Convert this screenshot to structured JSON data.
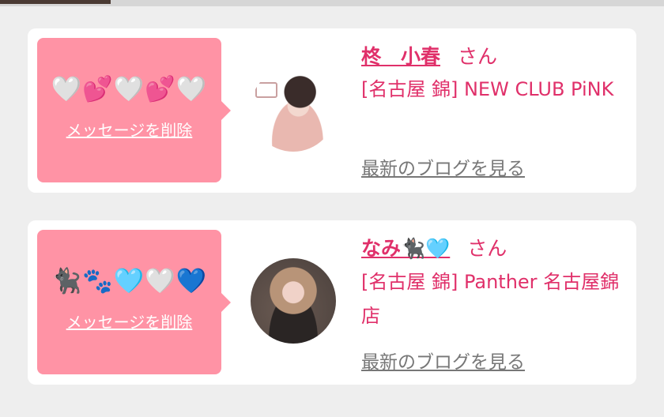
{
  "favorites": [
    {
      "name": "柊　小春",
      "suffix": "さん",
      "shop": "[名古屋 錦] NEW CLUB PiNK",
      "message": "🤍💕🤍💕🤍",
      "delete_label": "メッセージを削除",
      "blog_label": "最新のブログを見る"
    },
    {
      "name": "なみ🐈‍⬛🩵",
      "suffix": "さん",
      "shop": "[名古屋 錦] Panther 名古屋錦店",
      "message": "🐈‍⬛🐾🩵🤍💙",
      "delete_label": "メッセージを削除",
      "blog_label": "最新のブログを見る"
    }
  ],
  "colors": {
    "accent": "#e0306a",
    "bubble": "#ff93a5",
    "link_gray": "#777777",
    "background": "#eeeeee"
  }
}
